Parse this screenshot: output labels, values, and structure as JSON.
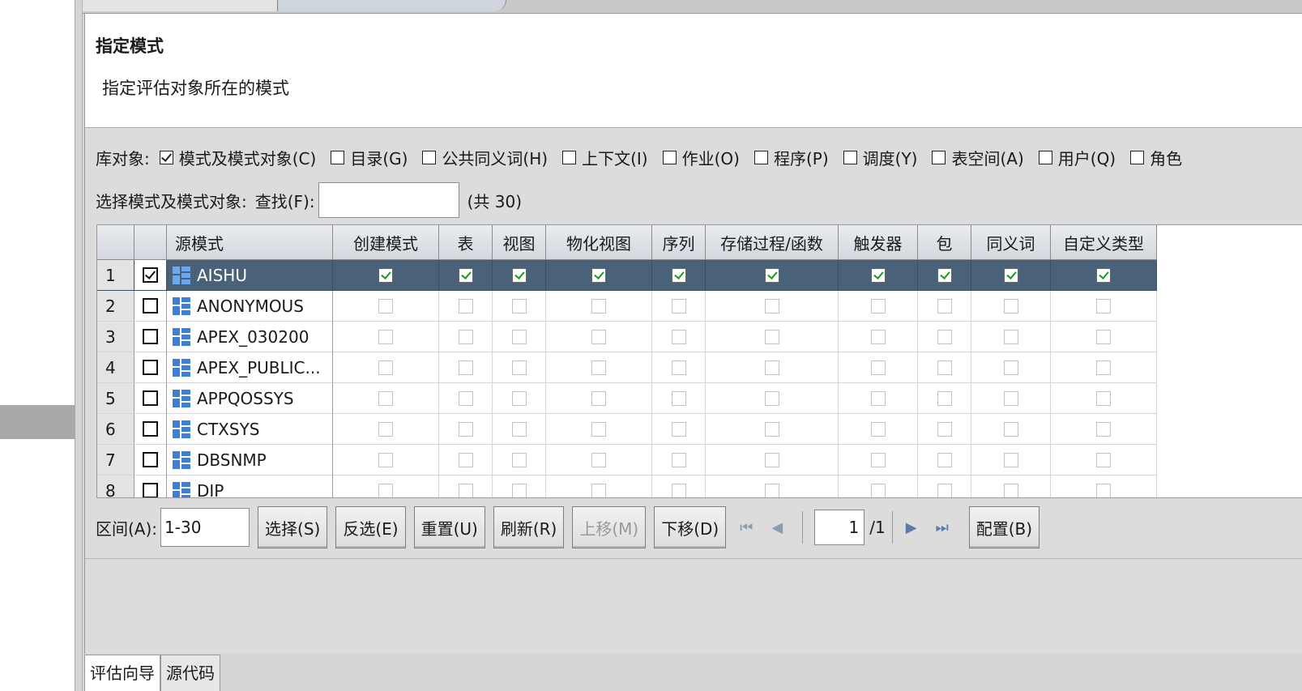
{
  "header": {
    "title": "指定模式",
    "description": "指定评估对象所在的模式"
  },
  "objects": {
    "label": "库对象:",
    "items": [
      {
        "label": "模式及模式对象(C)",
        "checked": true
      },
      {
        "label": "目录(G)",
        "checked": false
      },
      {
        "label": "公共同义词(H)",
        "checked": false
      },
      {
        "label": "上下文(I)",
        "checked": false
      },
      {
        "label": "作业(O)",
        "checked": false
      },
      {
        "label": "程序(P)",
        "checked": false
      },
      {
        "label": "调度(Y)",
        "checked": false
      },
      {
        "label": "表空间(A)",
        "checked": false
      },
      {
        "label": "用户(Q)",
        "checked": false
      },
      {
        "label": "角色",
        "checked": false
      }
    ]
  },
  "find": {
    "label": "选择模式及模式对象:",
    "find_label": "查找(F):",
    "value": "",
    "count": "(共 30)"
  },
  "table": {
    "columns": [
      "",
      "",
      "源模式",
      "创建模式",
      "表",
      "视图",
      "物化视图",
      "序列",
      "存储过程/函数",
      "触发器",
      "包",
      "同义词",
      "自定义类型"
    ],
    "rows": [
      {
        "num": "1",
        "checked": true,
        "name": "AISHU",
        "selected": true
      },
      {
        "num": "2",
        "checked": false,
        "name": "ANONYMOUS"
      },
      {
        "num": "3",
        "checked": false,
        "name": "APEX_030200"
      },
      {
        "num": "4",
        "checked": false,
        "name": "APEX_PUBLIC..."
      },
      {
        "num": "5",
        "checked": false,
        "name": "APPQOSSYS"
      },
      {
        "num": "6",
        "checked": false,
        "name": "CTXSYS"
      },
      {
        "num": "7",
        "checked": false,
        "name": "DBSNMP"
      },
      {
        "num": "8",
        "checked": false,
        "name": "DIP"
      }
    ]
  },
  "toolbar": {
    "range_label": "区间(A):",
    "range_value": "1-30",
    "buttons": [
      {
        "label": "选择(S)",
        "enabled": true
      },
      {
        "label": "反选(E)",
        "enabled": true
      },
      {
        "label": "重置(U)",
        "enabled": true
      },
      {
        "label": "刷新(R)",
        "enabled": true
      },
      {
        "label": "上移(M)",
        "enabled": false
      },
      {
        "label": "下移(D)",
        "enabled": true
      }
    ],
    "page_value": "1",
    "page_total": "/1",
    "config_label": "配置(B)"
  },
  "bottom_tabs": [
    "评估向导",
    "源代码"
  ],
  "icons": {
    "schema": "schema-icon",
    "first": "first-page-icon",
    "prev": "prev-page-icon",
    "next": "next-page-icon",
    "last": "last-page-icon"
  }
}
